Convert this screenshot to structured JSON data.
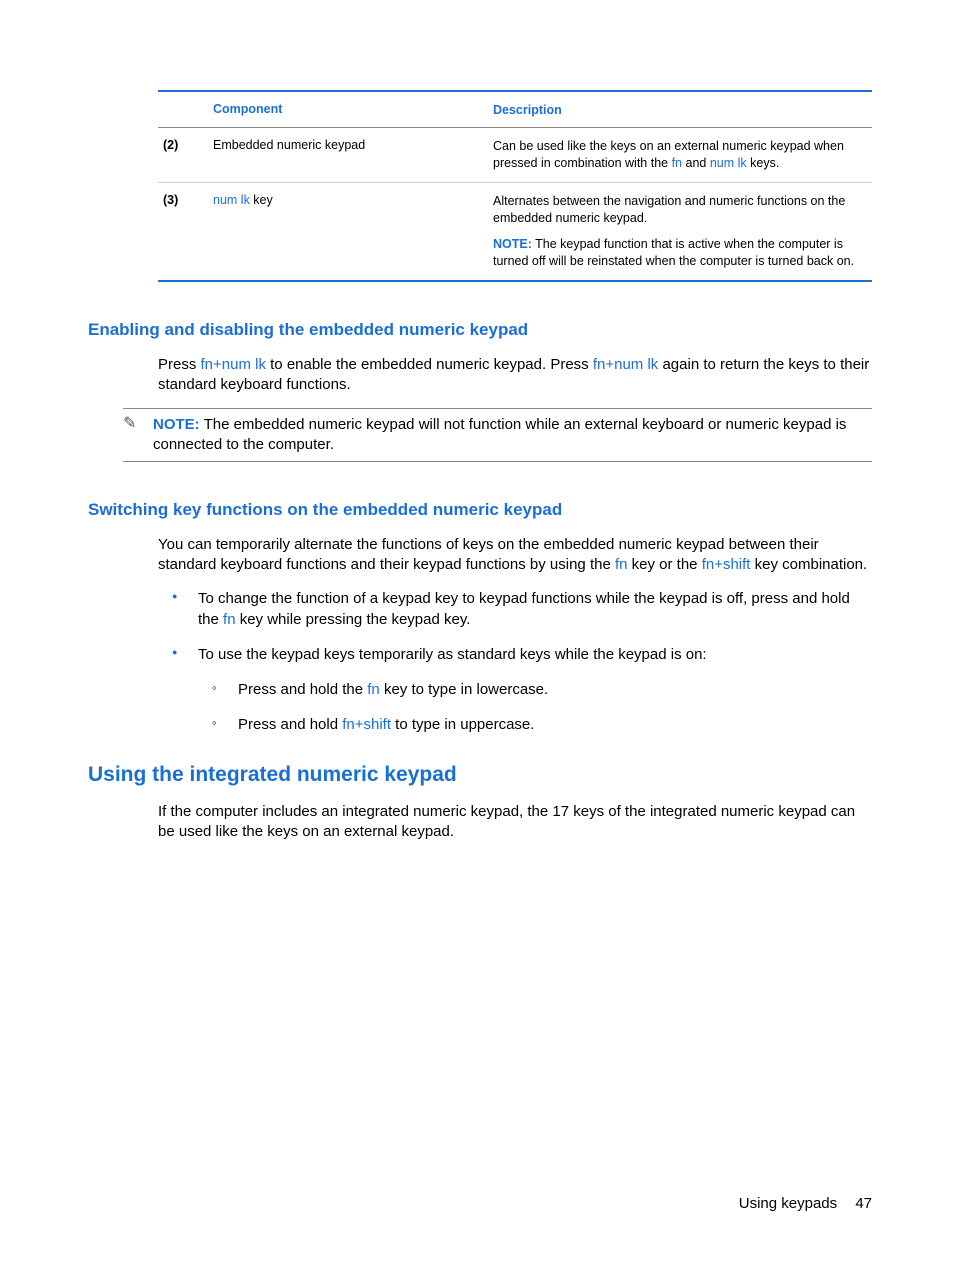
{
  "table": {
    "headers": {
      "component": "Component",
      "description": "Description"
    },
    "rows": [
      {
        "num": "(2)",
        "component_pre": "Embedded numeric keypad",
        "component_key": "",
        "component_post": "",
        "desc1_pre": "Can be used like the keys on an external numeric keypad when pressed in combination with the ",
        "desc1_k1": "fn",
        "desc1_mid": " and ",
        "desc1_k2": "num lk",
        "desc1_post": " keys.",
        "has_note": false
      },
      {
        "num": "(3)",
        "component_pre": "",
        "component_key": "num lk",
        "component_post": " key",
        "desc1_pre": "Alternates between the navigation and numeric functions on the embedded numeric keypad.",
        "desc1_k1": "",
        "desc1_mid": "",
        "desc1_k2": "",
        "desc1_post": "",
        "has_note": true,
        "note_label": "NOTE:",
        "note_text": "   The keypad function that is active when the computer is turned off will be reinstated when the computer is turned back on."
      }
    ]
  },
  "section1": {
    "title": "Enabling and disabling the embedded numeric keypad",
    "p1_a": "Press ",
    "p1_k1": "fn+num lk",
    "p1_b": " to enable the embedded numeric keypad. Press ",
    "p1_k2": "fn+num lk",
    "p1_c": " again to return the keys to their standard keyboard functions.",
    "note_label": "NOTE:",
    "note_text": "   The embedded numeric keypad will not function while an external keyboard or numeric keypad is connected to the computer."
  },
  "section2": {
    "title": "Switching key functions on the embedded numeric keypad",
    "p1_a": "You can temporarily alternate the functions of keys on the embedded numeric keypad between their standard keyboard functions and their keypad functions by using the ",
    "p1_k1": "fn",
    "p1_b": " key or the ",
    "p1_k2": "fn+shift",
    "p1_c": " key combination.",
    "b1_a": "To change the function of a keypad key to keypad functions while the keypad is off, press and hold the ",
    "b1_k": "fn",
    "b1_b": " key while pressing the keypad key.",
    "b2": "To use the keypad keys temporarily as standard keys while the keypad is on:",
    "s1_a": "Press and hold the ",
    "s1_k": "fn",
    "s1_b": " key to type in lowercase.",
    "s2_a": "Press and hold ",
    "s2_k": "fn+shift",
    "s2_b": " to type in uppercase."
  },
  "section3": {
    "title": "Using the integrated numeric keypad",
    "p1": "If the computer includes an integrated numeric keypad, the 17 keys of the integrated numeric keypad can be used like the keys on an external keypad."
  },
  "footer": {
    "label": "Using keypads",
    "page": "47"
  },
  "icons": {
    "note": "✎"
  }
}
